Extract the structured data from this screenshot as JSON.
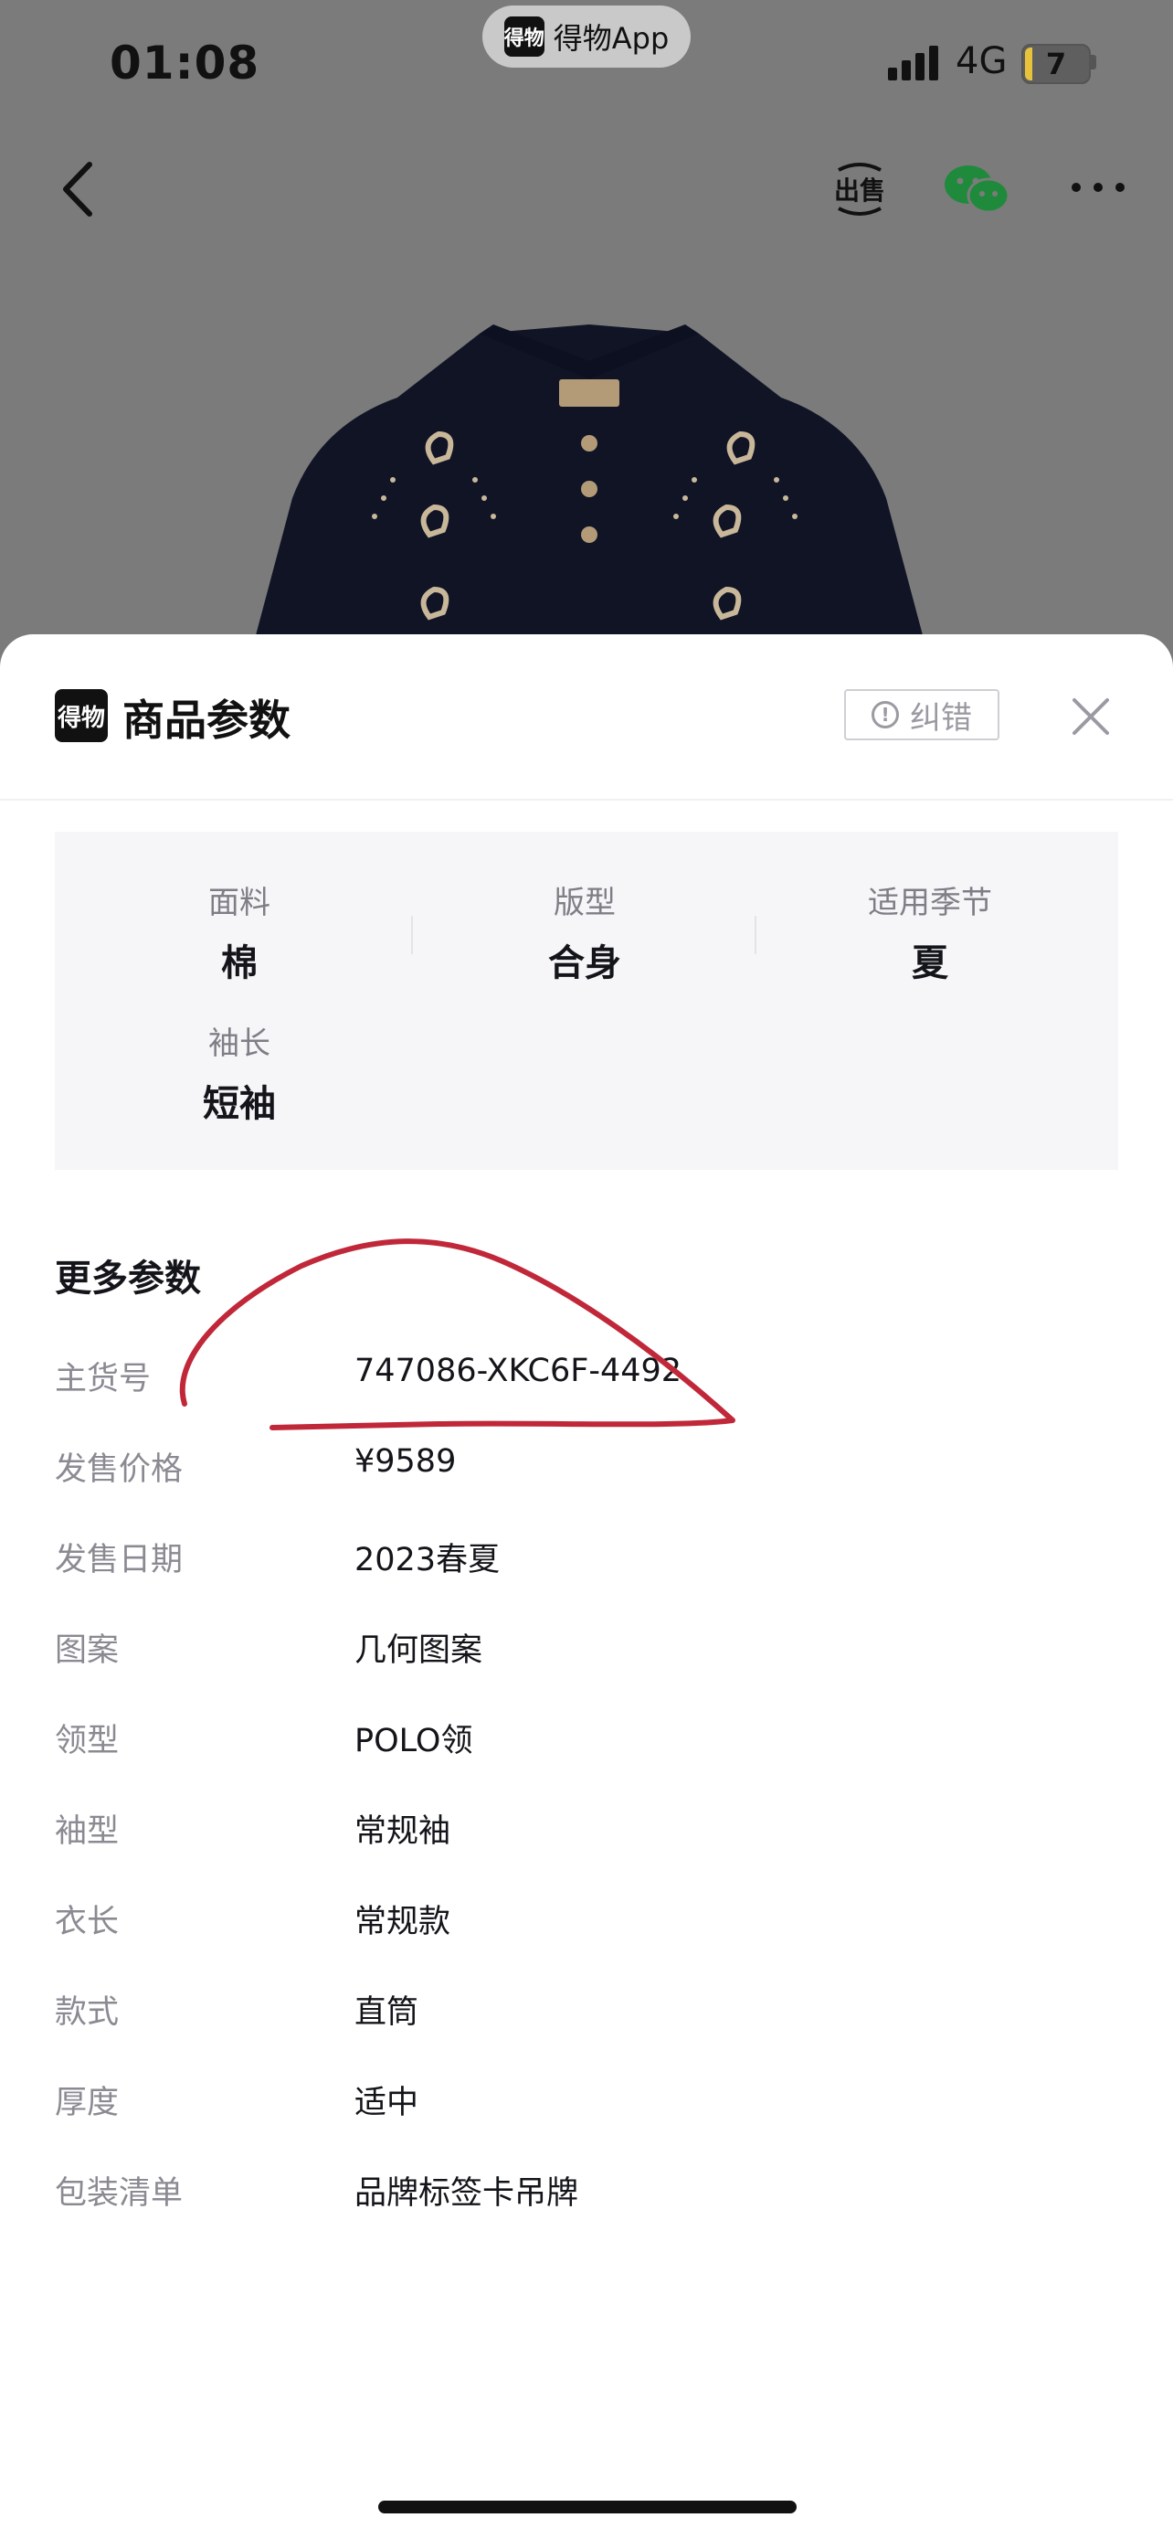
{
  "status_bar": {
    "time": "01:08",
    "network": "4G",
    "battery": "7"
  },
  "app_pill": {
    "logo": "得物",
    "label": "得物App"
  },
  "nav": {
    "sell_icon": "sell-icon",
    "share_icon": "wechat-icon"
  },
  "sheet": {
    "logo": "得物",
    "title": "商品参数",
    "report_label": "纠错",
    "attributes": [
      {
        "label": "面料",
        "value": "棉"
      },
      {
        "label": "版型",
        "value": "合身"
      },
      {
        "label": "适用季节",
        "value": "夏"
      },
      {
        "label": "袖长",
        "value": "短袖"
      }
    ],
    "more_title": "更多参数",
    "params": [
      {
        "label": "主货号",
        "value": "747086-XKC6F-4492"
      },
      {
        "label": "发售价格",
        "value": "¥9589"
      },
      {
        "label": "发售日期",
        "value": "2023春夏"
      },
      {
        "label": "图案",
        "value": "几何图案"
      },
      {
        "label": "领型",
        "value": "POLO领"
      },
      {
        "label": "袖型",
        "value": "常规袖"
      },
      {
        "label": "衣长",
        "value": "常规款"
      },
      {
        "label": "款式",
        "value": "直筒"
      },
      {
        "label": "厚度",
        "value": "适中"
      },
      {
        "label": "包装清单",
        "value": "品牌标签卡吊牌"
      }
    ]
  },
  "colors": {
    "annotation": "#c0283a",
    "overlay": "#7b7b7b",
    "panel": "#f6f6f8"
  }
}
